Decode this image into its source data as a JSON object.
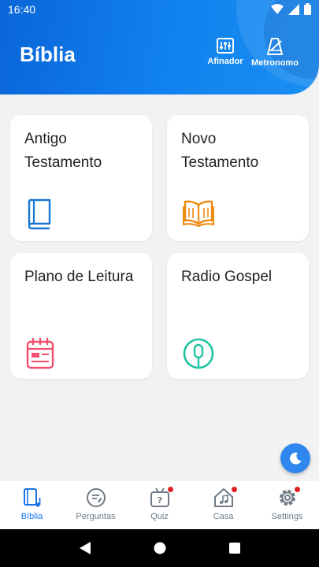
{
  "status_bar": {
    "time": "16:40"
  },
  "header": {
    "title": "Bíblia",
    "tools": [
      {
        "label": "Afinador",
        "icon": "tuner-sliders-icon"
      },
      {
        "label": "Metronomo",
        "icon": "metronome-icon"
      }
    ]
  },
  "cards": [
    {
      "label": "Antigo\nTestamento",
      "icon": "book-closed-icon",
      "color": "#1976d2"
    },
    {
      "label": "Novo\nTestamento",
      "icon": "book-open-icon",
      "color": "#f08a10"
    },
    {
      "label": "Plano de Leitura",
      "icon": "calendar-icon",
      "color": "#f0506e"
    },
    {
      "label": "Radio Gospel",
      "icon": "microphone-icon",
      "color": "#22c3a0"
    }
  ],
  "fab": {
    "icon": "moon-icon"
  },
  "bottom_nav": [
    {
      "label": "Bíblia",
      "icon": "bible-music-icon",
      "active": true
    },
    {
      "label": "Perguntas",
      "icon": "questions-icon"
    },
    {
      "label": "Quiz",
      "icon": "quiz-icon",
      "badge": true
    },
    {
      "label": "Casa",
      "icon": "music-house-icon",
      "badge": true
    },
    {
      "label": "Settings",
      "icon": "gear-icon",
      "badge": true
    }
  ],
  "colors": {
    "primary": "#1a73e8",
    "badge": "#e02020"
  }
}
